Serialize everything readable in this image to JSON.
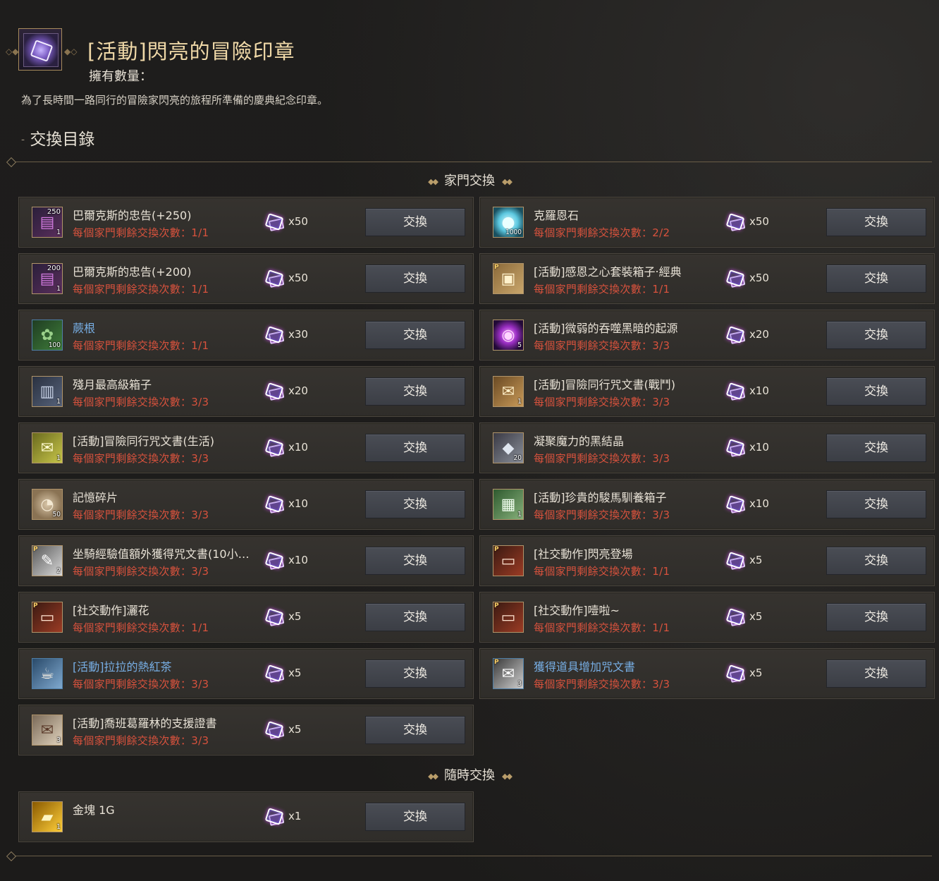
{
  "header": {
    "title": "[活動]閃亮的冒險印章",
    "owned_label": "擁有數量：",
    "description": "為了長時間一路同行的冒險家閃亮的旅程所準備的慶典紀念印章。"
  },
  "section_title": "交換目錄",
  "section_dash": "-",
  "colors": {
    "title": "#f0d9a8",
    "limit_red": "#d8523d",
    "name_blue": "#77aee4",
    "button": "#43464d"
  },
  "groups": [
    {
      "label": "家門交換",
      "items": [
        {
          "name": "巴爾克斯的忠告(+250)",
          "limit": "每個家門剩餘交換次數：1/1",
          "cost": "x50",
          "button": "交換",
          "icon": "scroll-purple-icon",
          "count": "1",
          "top": "250"
        },
        {
          "name": "克羅恩石",
          "limit": "每個家門剩餘交換次數：2/2",
          "cost": "x50",
          "button": "交換",
          "icon": "crystal-orb-icon",
          "count": "1000"
        },
        {
          "name": "巴爾克斯的忠告(+200)",
          "limit": "每個家門剩餘交換次數：1/1",
          "cost": "x50",
          "button": "交換",
          "icon": "scroll-purple-icon",
          "count": "1",
          "top": "200"
        },
        {
          "name": "[活動]感恩之心套裝箱子‧經典",
          "limit": "每個家門剩餘交換次數：1/1",
          "cost": "x50",
          "button": "交換",
          "icon": "outfit-box-icon",
          "ptag": "P"
        },
        {
          "name": "蕨根",
          "limit": "每個家門剩餘交換次數：1/1",
          "cost": "x30",
          "button": "交換",
          "icon": "fern-icon",
          "count": "100",
          "blue": true
        },
        {
          "name": "[活動]微弱的吞噬黑暗的起源",
          "limit": "每個家門剩餘交換次數：3/3",
          "cost": "x20",
          "button": "交換",
          "icon": "dark-vortex-icon",
          "count": "5"
        },
        {
          "name": "殘月最高級箱子",
          "limit": "每個家門剩餘交換次數：3/3",
          "cost": "x20",
          "button": "交換",
          "icon": "chest-icon",
          "count": "1"
        },
        {
          "name": "[活動]冒險同行咒文書(戰鬥)",
          "limit": "每個家門剩餘交換次數：3/3",
          "cost": "x10",
          "button": "交換",
          "icon": "scroll-combat-icon",
          "count": "1"
        },
        {
          "name": "[活動]冒險同行咒文書(生活)",
          "limit": "每個家門剩餘交換次數：3/3",
          "cost": "x10",
          "button": "交換",
          "icon": "scroll-life-icon",
          "count": "1"
        },
        {
          "name": "凝聚魔力的黑結晶",
          "limit": "每個家門剩餘交換次數：3/3",
          "cost": "x10",
          "button": "交換",
          "icon": "black-crystal-icon",
          "count": "20"
        },
        {
          "name": "記憶碎片",
          "limit": "每個家門剩餘交換次數：3/3",
          "cost": "x10",
          "button": "交換",
          "icon": "memory-fragment-icon",
          "count": "50"
        },
        {
          "name": "[活動]珍貴的駿馬馴養箱子",
          "limit": "每個家門剩餘交換次數：3/3",
          "cost": "x10",
          "button": "交換",
          "icon": "gift-box-icon",
          "count": "1"
        },
        {
          "name": "坐騎經驗值額外獲得咒文書(10小…",
          "limit": "每個家門剩餘交換次數：3/3",
          "cost": "x10",
          "button": "交換",
          "icon": "mount-scroll-icon",
          "count": "2",
          "ptag": "P"
        },
        {
          "name": "[社交動作]閃亮登場",
          "limit": "每個家門剩餘交換次數：1/1",
          "cost": "x5",
          "button": "交換",
          "icon": "social-ticket-icon",
          "ptag": "P"
        },
        {
          "name": "[社交動作]灑花",
          "limit": "每個家門剩餘交換次數：1/1",
          "cost": "x5",
          "button": "交換",
          "icon": "social-ticket-icon",
          "ptag": "P"
        },
        {
          "name": "[社交動作]噎啦~",
          "limit": "每個家門剩餘交換次數：1/1",
          "cost": "x5",
          "button": "交換",
          "icon": "social-ticket-icon",
          "ptag": "P"
        },
        {
          "name": "[活動]拉拉的熱紅茶",
          "limit": "每個家門剩餘交換次數：3/3",
          "cost": "x5",
          "button": "交換",
          "icon": "tea-cup-icon",
          "blue": true
        },
        {
          "name": "獲得道具增加咒文書",
          "limit": "每個家門剩餘交換次數：3/3",
          "cost": "x5",
          "button": "交換",
          "icon": "item-scroll-icon",
          "count": "3",
          "ptag": "P",
          "blue": true
        },
        {
          "name": "[活動]喬班葛羅林的支援證書",
          "limit": "每個家門剩餘交換次數：3/3",
          "cost": "x5",
          "button": "交換",
          "icon": "certificate-icon",
          "count": "3"
        }
      ]
    },
    {
      "label": "隨時交換",
      "items": [
        {
          "name": "金塊 1G",
          "limit": "",
          "cost": "x1",
          "button": "交換",
          "icon": "gold-bar-icon",
          "count": "1"
        }
      ]
    }
  ]
}
